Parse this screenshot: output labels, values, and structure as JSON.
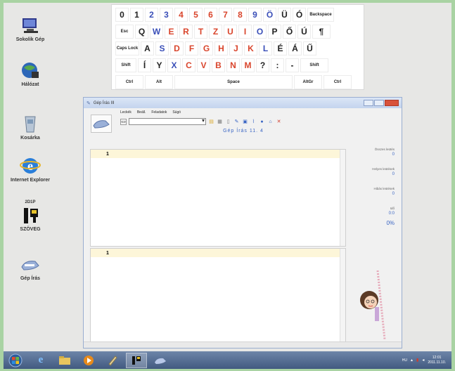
{
  "desktop": {
    "icons": [
      {
        "label": "Sokolik Gép",
        "icon": "computer-icon"
      },
      {
        "label": "Hálózat",
        "icon": "network-icon"
      },
      {
        "label": "Kosárka",
        "icon": "recycle-bin-icon"
      },
      {
        "label": "Internet Explorer",
        "icon": "internet-explorer-icon"
      },
      {
        "label": "SZÖVEG",
        "icon": "typewriter-app-icon"
      },
      {
        "label": "Gép Írás",
        "icon": "typing-tutor-icon"
      }
    ],
    "typing_app_icon_caption": "2D1P"
  },
  "keyboard": {
    "rows": [
      [
        {
          "t": "0",
          "c": "black"
        },
        {
          "t": "1",
          "c": "black"
        },
        {
          "t": "2",
          "c": "blue"
        },
        {
          "t": "3",
          "c": "blue"
        },
        {
          "t": "4",
          "c": "red"
        },
        {
          "t": "5",
          "c": "red"
        },
        {
          "t": "6",
          "c": "red"
        },
        {
          "t": "7",
          "c": "red"
        },
        {
          "t": "8",
          "c": "red"
        },
        {
          "t": "9",
          "c": "blue"
        },
        {
          "t": "Ö",
          "c": "blue"
        },
        {
          "t": "Ü",
          "c": "black"
        },
        {
          "t": "Ó",
          "c": "black"
        },
        {
          "t": "Backspace",
          "c": "black",
          "sm": true,
          "w": 38
        }
      ],
      [
        {
          "t": "Esc",
          "c": "black",
          "sm": true,
          "w": 26
        },
        {
          "t": "Q",
          "c": "black"
        },
        {
          "t": "W",
          "c": "blue"
        },
        {
          "t": "E",
          "c": "red"
        },
        {
          "t": "R",
          "c": "red"
        },
        {
          "t": "T",
          "c": "red"
        },
        {
          "t": "Z",
          "c": "red"
        },
        {
          "t": "U",
          "c": "red"
        },
        {
          "t": "I",
          "c": "red"
        },
        {
          "t": "O",
          "c": "blue"
        },
        {
          "t": "P",
          "c": "black"
        },
        {
          "t": "Ő",
          "c": "black"
        },
        {
          "t": "Ú",
          "c": "black"
        },
        {
          "t": "¶",
          "c": "black",
          "w": 26
        }
      ],
      [
        {
          "t": "Caps Lock",
          "c": "black",
          "sm": true,
          "w": 34
        },
        {
          "t": "A",
          "c": "black"
        },
        {
          "t": "S",
          "c": "blue"
        },
        {
          "t": "D",
          "c": "red"
        },
        {
          "t": "F",
          "c": "red"
        },
        {
          "t": "G",
          "c": "red"
        },
        {
          "t": "H",
          "c": "red"
        },
        {
          "t": "J",
          "c": "red"
        },
        {
          "t": "K",
          "c": "red"
        },
        {
          "t": "L",
          "c": "blue"
        },
        {
          "t": "É",
          "c": "black"
        },
        {
          "t": "Á",
          "c": "black"
        },
        {
          "t": "Ű",
          "c": "black"
        }
      ],
      [
        {
          "t": "Shift",
          "c": "black",
          "sm": true,
          "w": 30
        },
        {
          "t": "Í",
          "c": "black"
        },
        {
          "t": "Y",
          "c": "black"
        },
        {
          "t": "X",
          "c": "blue"
        },
        {
          "t": "C",
          "c": "red"
        },
        {
          "t": "V",
          "c": "red"
        },
        {
          "t": "B",
          "c": "red"
        },
        {
          "t": "N",
          "c": "red"
        },
        {
          "t": "M",
          "c": "red"
        },
        {
          "t": "?",
          "c": "black"
        },
        {
          "t": ":",
          "c": "black"
        },
        {
          "t": "-",
          "c": "black"
        },
        {
          "t": "Shift",
          "c": "black",
          "sm": true,
          "w": 40
        }
      ],
      [
        {
          "t": "Ctrl",
          "c": "black",
          "sm": true,
          "w": 40
        },
        {
          "t": "Alt",
          "c": "black",
          "sm": true,
          "w": 40
        },
        {
          "t": "Space",
          "c": "black",
          "sm": true,
          "w": 168
        },
        {
          "t": "AltGr",
          "c": "black",
          "sm": true,
          "w": 40
        },
        {
          "t": "Ctrl",
          "c": "black",
          "sm": true,
          "w": 40
        }
      ]
    ]
  },
  "window": {
    "title": "Gép Írás III",
    "menu": [
      "Leckék",
      "Beáll.",
      "Feladatok",
      "Súgó"
    ],
    "doc_title": "Gép Írás  11. 4",
    "top_pane_line_number": "1",
    "bottom_pane_line_number": "1",
    "stats": [
      {
        "label": "Összes leütés",
        "value": "0"
      },
      {
        "label": "Helyes leütések",
        "value": "0"
      },
      {
        "label": "Hibás leütések",
        "value": "0"
      },
      {
        "label": "Idő",
        "value": "0:0"
      }
    ],
    "progress": "0%"
  },
  "taskbar": {
    "clock_time": "12:01",
    "clock_date": "2011.11.10."
  }
}
